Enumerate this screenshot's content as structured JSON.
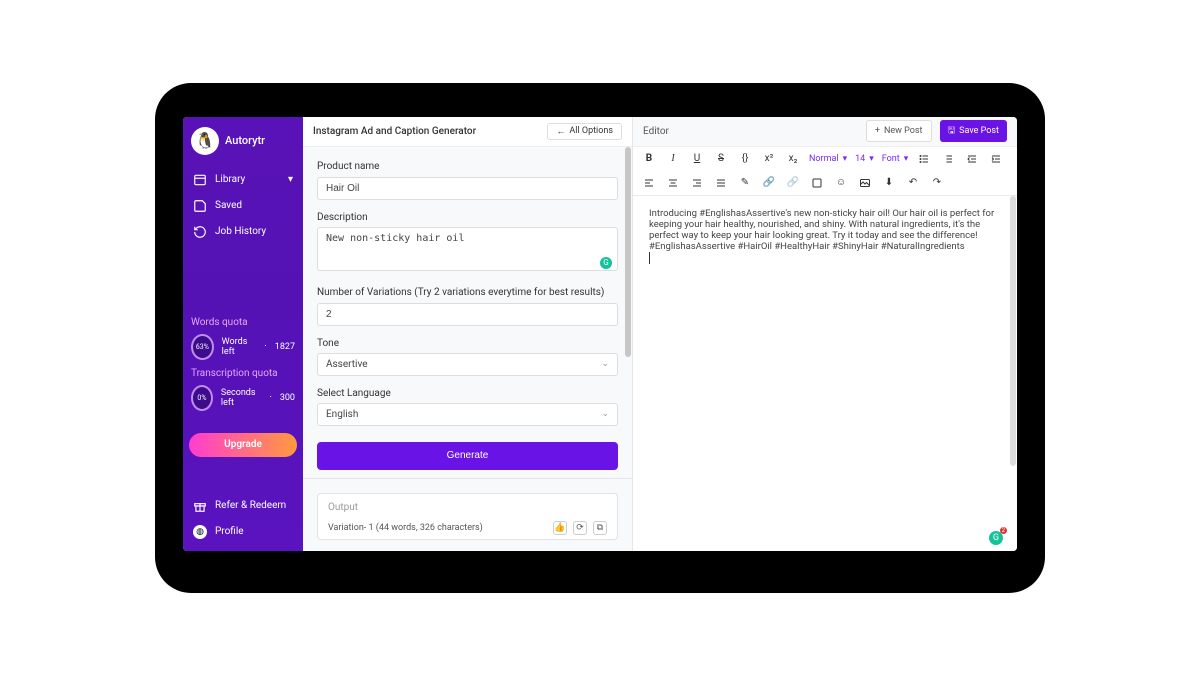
{
  "brand": {
    "name": "Autorytr",
    "logo_emoji": "🐧"
  },
  "sidebar": {
    "nav": [
      {
        "icon": "library-icon",
        "label": "Library",
        "chevron": true
      },
      {
        "icon": "saved-icon",
        "label": "Saved"
      },
      {
        "icon": "history-icon",
        "label": "Job History"
      }
    ],
    "words_quota": {
      "title": "Words quota",
      "pct": "63%",
      "label": "Words left",
      "value": "1827"
    },
    "trans_quota": {
      "title": "Transcription quota",
      "pct": "0%",
      "label": "Seconds left",
      "value": "300"
    },
    "upgrade_label": "Upgrade",
    "bottom": [
      {
        "icon": "gift-icon",
        "label": "Refer & Redeem"
      },
      {
        "icon": "profile-icon",
        "label": "Profile"
      }
    ]
  },
  "form": {
    "title": "Instagram Ad and Caption Generator",
    "all_options": "All Options",
    "product_name_label": "Product name",
    "product_name_value": "Hair Oil",
    "description_label": "Description",
    "description_value": "New non-sticky hair oil",
    "variations_label": "Number of Variations (Try 2 variations everytime for best results)",
    "variations_value": "2",
    "tone_label": "Tone",
    "tone_value": "Assertive",
    "language_label": "Select Language",
    "language_value": "English",
    "generate_label": "Generate",
    "output": {
      "title": "Output",
      "variation_line": "Variation- 1 (44 words, 326 characters)"
    }
  },
  "editor": {
    "title": "Editor",
    "new_post": "New Post",
    "save_post": "Save Post",
    "toolbar": {
      "format": "Normal",
      "size": "14",
      "font": "Font"
    },
    "content": "Introducing #EnglishasAssertive's new non-sticky hair oil! Our hair oil is perfect for keeping your hair healthy, nourished, and shiny. With natural ingredients, it's the perfect way to keep your hair looking great. Try it today and see the difference! #EnglishasAssertive #HairOil #HealthyHair #ShinyHair #NaturalIngredients"
  }
}
